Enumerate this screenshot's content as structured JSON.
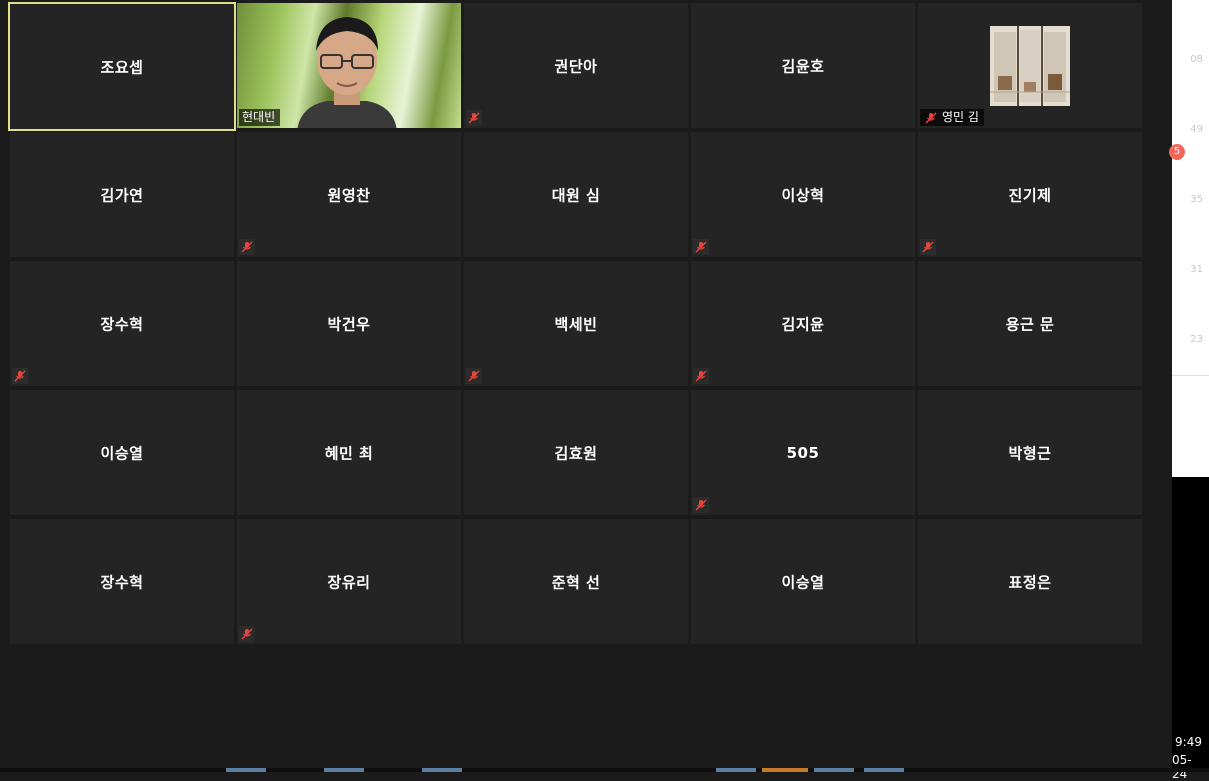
{
  "participants": [
    {
      "name": "조요셉",
      "muted": false,
      "active": true,
      "video": false
    },
    {
      "name": "현대빈",
      "muted": false,
      "active": false,
      "video": true
    },
    {
      "name": "권단아",
      "muted": true,
      "active": false,
      "video": false
    },
    {
      "name": "김윤호",
      "muted": false,
      "active": false,
      "video": false
    },
    {
      "name": "영민 김",
      "muted": true,
      "active": false,
      "video": "thumbnail"
    },
    {
      "name": "김가연",
      "muted": false,
      "active": false,
      "video": false
    },
    {
      "name": "원영찬",
      "muted": true,
      "active": false,
      "video": false
    },
    {
      "name": "대원 심",
      "muted": false,
      "active": false,
      "video": false
    },
    {
      "name": "이상혁",
      "muted": true,
      "active": false,
      "video": false
    },
    {
      "name": "진기제",
      "muted": true,
      "active": false,
      "video": false
    },
    {
      "name": "장수혁",
      "muted": true,
      "active": false,
      "video": false
    },
    {
      "name": "박건우",
      "muted": false,
      "active": false,
      "video": false
    },
    {
      "name": "백세빈",
      "muted": true,
      "active": false,
      "video": false
    },
    {
      "name": "김지윤",
      "muted": true,
      "active": false,
      "video": false
    },
    {
      "name": "용근 문",
      "muted": false,
      "active": false,
      "video": false
    },
    {
      "name": "이승열",
      "muted": false,
      "active": false,
      "video": false
    },
    {
      "name": "혜민 최",
      "muted": false,
      "active": false,
      "video": false
    },
    {
      "name": "김효원",
      "muted": false,
      "active": false,
      "video": false
    },
    {
      "name": "505",
      "muted": true,
      "active": false,
      "video": false
    },
    {
      "name": "박형근",
      "muted": false,
      "active": false,
      "video": false
    },
    {
      "name": "장수혁",
      "muted": false,
      "active": false,
      "video": false
    },
    {
      "name": "장유리",
      "muted": true,
      "active": false,
      "video": false
    },
    {
      "name": "준혁 선",
      "muted": false,
      "active": false,
      "video": false
    },
    {
      "name": "이승열",
      "muted": false,
      "active": false,
      "video": false
    },
    {
      "name": "표정은",
      "muted": false,
      "active": false,
      "video": false
    }
  ],
  "side_panel": {
    "timestamps": [
      "08",
      "49",
      "35",
      "31",
      "23"
    ],
    "badge": "5"
  },
  "clock": {
    "time": "9:49",
    "date": "05-24"
  },
  "colors": {
    "tile_bg": "#242424",
    "active_border": "#e0e08a",
    "mute_icon": "#e8453c",
    "badge": "#f2665c"
  },
  "icons": {
    "mute": "microphone-muted-icon"
  }
}
